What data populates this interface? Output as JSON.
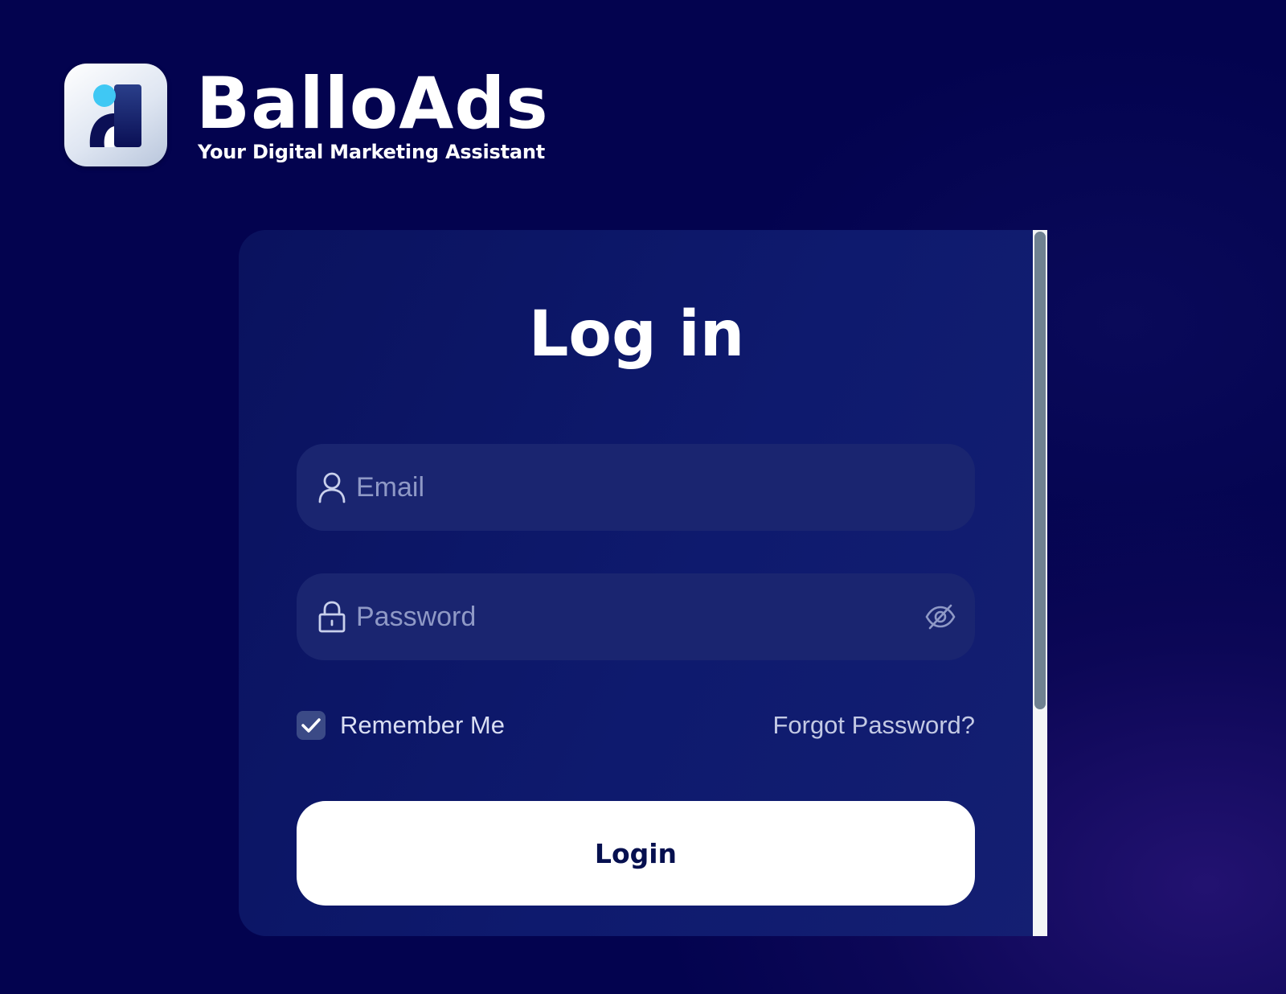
{
  "brand": {
    "name": "BalloAds",
    "tagline": "Your Digital Marketing Assistant",
    "logo_icon": "balloads-logo-icon",
    "accent_color": "#3fc8f4"
  },
  "login": {
    "title": "Log in",
    "email": {
      "placeholder": "Email",
      "value": "",
      "icon": "user-icon"
    },
    "password": {
      "placeholder": "Password",
      "value": "",
      "icon": "lock-icon",
      "toggle_icon": "eye-off-icon"
    },
    "remember_me": {
      "label": "Remember Me",
      "checked": true
    },
    "forgot_password_label": "Forgot Password?",
    "submit_label": "Login"
  },
  "scrollbar": {
    "visible_fraction": 0.68
  },
  "colors": {
    "background": "#03034f",
    "card": "#0e1a6e",
    "field": "#1a2570",
    "button": "#ffffff",
    "button_text": "#06104f"
  }
}
